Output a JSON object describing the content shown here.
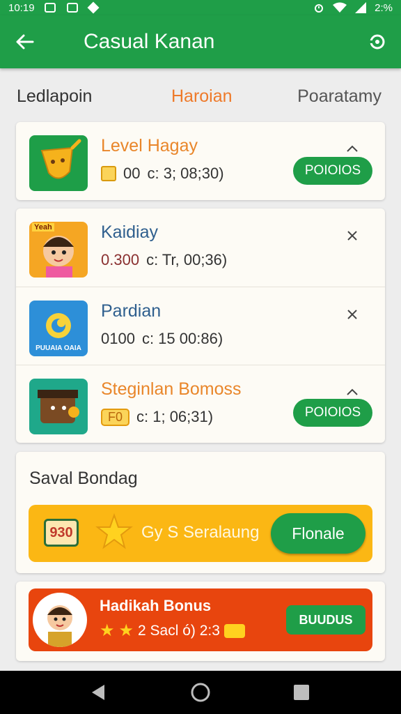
{
  "status_bar": {
    "time": "10:19",
    "battery": "2:%"
  },
  "app_bar": {
    "title": "Casual Kanan"
  },
  "tabs": [
    {
      "label": "Ledlapoin"
    },
    {
      "label": "Haroian"
    },
    {
      "label": "Poaratamy"
    }
  ],
  "list": [
    {
      "title": "Level Hagay",
      "title_color": "#e9862a",
      "value": "00",
      "meta": "c: 3; 08;30)",
      "control": "chevron-up",
      "button": "POIOIOS",
      "icon_bg": "#1e9e48"
    },
    {
      "title": "Kaidiay",
      "title_color": "#2f5f8e",
      "value": "0.300",
      "meta": "c: Tr, 00;36)",
      "control": "close",
      "button": "",
      "icon_bg": "#f5a623",
      "icon_text": "Yeah"
    },
    {
      "title": "Pardian",
      "title_color": "#2f5f8e",
      "value": "0100",
      "meta": "c: 15 00:86)",
      "control": "close",
      "button": "",
      "icon_bg": "#2d8fd8",
      "icon_text": "PUUAIA OAIA"
    },
    {
      "title": "Steginlan Bomoss",
      "title_color": "#e9862a",
      "value": "F0",
      "meta": "c: 1; 06;31)",
      "control": "chevron-up",
      "button": "POIOIOS",
      "icon_bg": "#1fa88a"
    }
  ],
  "daily": {
    "title": "Saval Bondag",
    "ticket": "930",
    "text": "Gy S Seralaung",
    "button": "Flonale"
  },
  "bonus": {
    "title": "Hadikah Bonus",
    "text": "2 Sacl ó) 2:3",
    "button": "BUUDUS"
  }
}
